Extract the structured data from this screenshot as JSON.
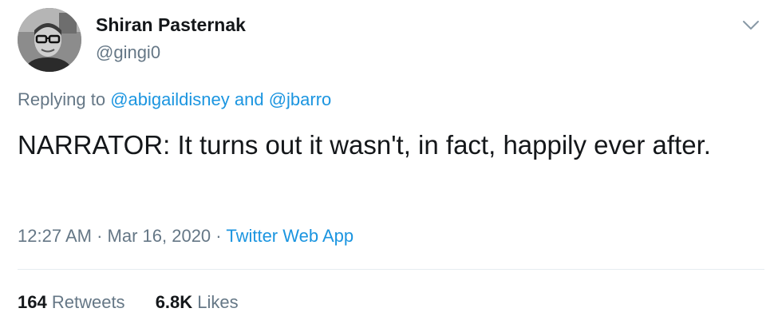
{
  "author": {
    "display_name": "Shiran Pasternak",
    "handle": "@gingi0",
    "avatar_icon": "person-photo-avatar"
  },
  "menu": {
    "icon": "chevron-down-icon"
  },
  "reply": {
    "prefix": "Replying to",
    "mention1": "@abigaildisney",
    "conjunction": "and",
    "mention2": "@jbarro"
  },
  "tweet": {
    "text": "NARRATOR: It turns out it wasn't, in fact, happily ever after."
  },
  "meta": {
    "time": "12:27 AM",
    "separator1": "·",
    "date": "Mar 16, 2020",
    "separator2": "·",
    "source": "Twitter Web App"
  },
  "stats": {
    "retweets_count": "164",
    "retweets_label": "Retweets",
    "likes_count": "6.8K",
    "likes_label": "Likes"
  },
  "colors": {
    "text": "#14171a",
    "secondary": "#657786",
    "link": "#1b95e0",
    "divider": "#e6ecf0"
  }
}
